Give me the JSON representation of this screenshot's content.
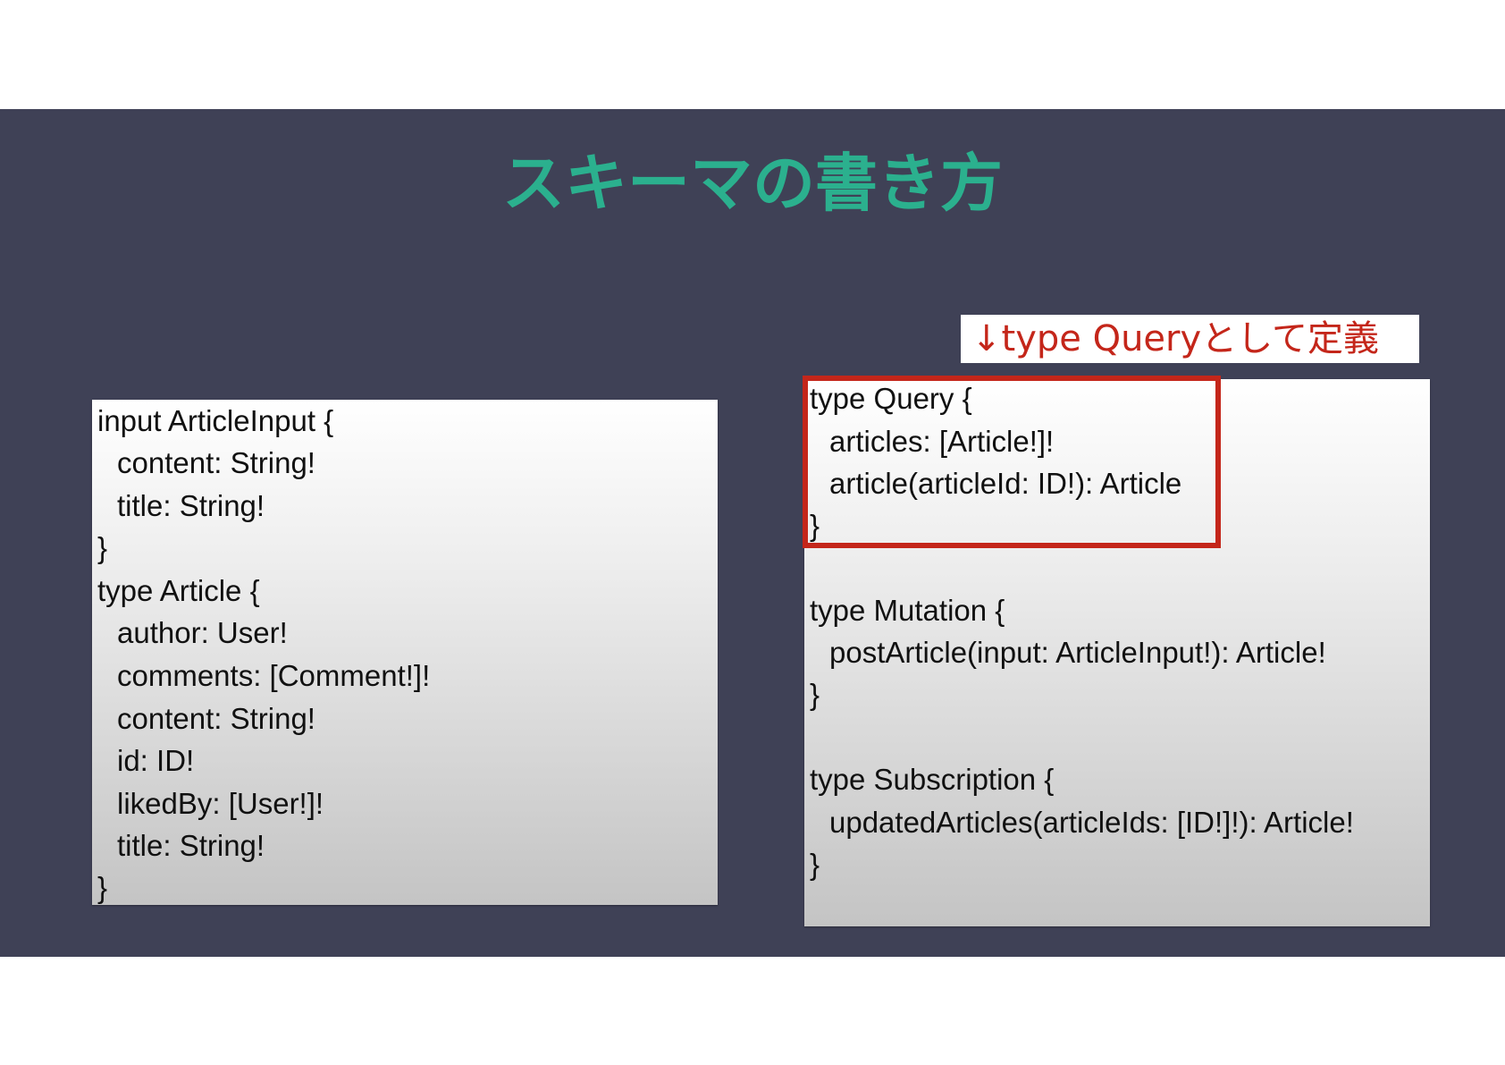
{
  "slide": {
    "title": "スキーマの書き方",
    "callout": "↓type Queryとして定義"
  },
  "left_code": [
    "input ArticleInput {",
    "content: String!",
    "title: String!",
    "}",
    "type Article {",
    "author: User!",
    "comments: [Comment!]!",
    "content: String!",
    "id: ID!",
    "likedBy: [User!]!",
    "title: String!",
    "}"
  ],
  "right_code": [
    "type Query {",
    "articles: [Article!]!",
    "article(articleId: ID!): Article",
    "}",
    "type Mutation {",
    "postArticle(input: ArticleInput!): Article!",
    "}",
    "type Subscription {",
    "updatedArticles(articleIds: [ID!]!): Article!",
    "}"
  ],
  "colors": {
    "slide_background": "#3f4156",
    "title": "#2bb08e",
    "highlight": "#c4261a"
  }
}
